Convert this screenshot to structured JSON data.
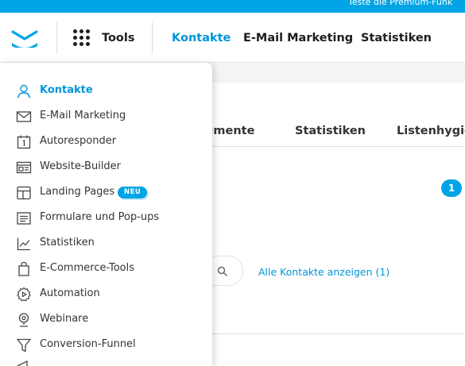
{
  "topbar": {
    "text": "Teste die Premium-Funk"
  },
  "header": {
    "tools_label": "Tools",
    "nav": [
      {
        "label": "Kontakte",
        "active": true
      },
      {
        "label": "E-Mail Marketing",
        "active": false
      },
      {
        "label": "Statistiken",
        "active": false
      }
    ]
  },
  "main": {
    "tabs": [
      "gmente",
      "Statistiken",
      "Listenhygie"
    ],
    "count_badge": "1",
    "all_contacts_link": "Alle Kontakte anzeigen (1)"
  },
  "dropdown": {
    "items": [
      {
        "label": "Kontakte",
        "icon": "user-icon",
        "active": true
      },
      {
        "label": "E-Mail Marketing",
        "icon": "envelope-icon"
      },
      {
        "label": "Autoresponder",
        "icon": "calendar-icon"
      },
      {
        "label": "Website-Builder",
        "icon": "website-icon"
      },
      {
        "label": "Landing Pages",
        "icon": "layout-icon",
        "badge": "NEU"
      },
      {
        "label": "Formulare und Pop-ups",
        "icon": "form-icon"
      },
      {
        "label": "Statistiken",
        "icon": "chart-icon"
      },
      {
        "label": "E-Commerce-Tools",
        "icon": "shopping-bag-icon"
      },
      {
        "label": "Automation",
        "icon": "automation-icon"
      },
      {
        "label": "Webinare",
        "icon": "webcam-icon"
      },
      {
        "label": "Conversion-Funnel",
        "icon": "funnel-icon"
      }
    ]
  },
  "colors": {
    "accent": "#00a4e4",
    "link": "#0095d9",
    "text": "#1d1d1d"
  }
}
